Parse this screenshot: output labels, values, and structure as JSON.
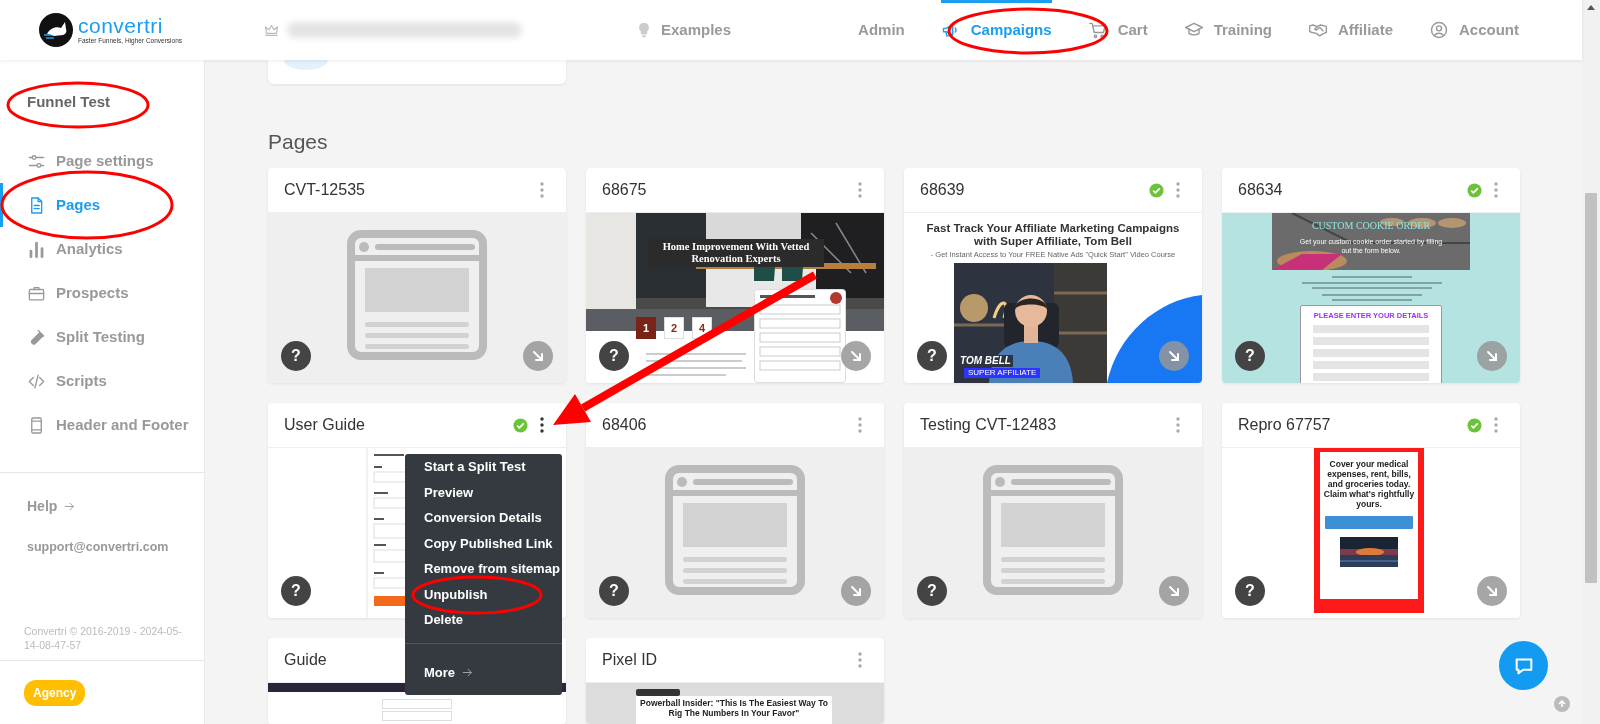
{
  "header": {
    "logo": "convertri",
    "tagline": "Faster Funnels, Higher Conversions",
    "examples": "Examples",
    "nav": [
      {
        "label": "Admin",
        "selected": false
      },
      {
        "label": "Campaigns",
        "selected": true
      },
      {
        "label": "Cart",
        "selected": false
      },
      {
        "label": "Training",
        "selected": false
      },
      {
        "label": "Affiliate",
        "selected": false
      },
      {
        "label": "Account",
        "selected": false
      }
    ]
  },
  "sidebar": {
    "title": "Funnel Test",
    "items": [
      {
        "label": "Page settings",
        "selected": false
      },
      {
        "label": "Pages",
        "selected": true
      },
      {
        "label": "Analytics",
        "selected": false
      },
      {
        "label": "Prospects",
        "selected": false
      },
      {
        "label": "Split Testing",
        "selected": false
      },
      {
        "label": "Scripts",
        "selected": false
      },
      {
        "label": "Header and Footer",
        "selected": false
      }
    ],
    "help": "Help",
    "support_email": "support@convertri.com",
    "copyright": "Convertri © 2016-2019 - 2024-05-14-08-47-57",
    "badge": "Agency"
  },
  "main": {
    "heading": "Pages",
    "cards": [
      {
        "title": "CVT-12535",
        "published": false,
        "menu_button": true,
        "help": "?",
        "open_button": true,
        "preview": {
          "kind": "placeholder"
        }
      },
      {
        "title": "68675",
        "published": false,
        "menu_button": true,
        "help": "?",
        "open_button": true,
        "preview": {
          "kind": "hero",
          "headline": "Home Improvement With Vetted Renovation Experts",
          "steps": [
            {
              "label": "1",
              "selected": true
            },
            {
              "label": "2",
              "selected": false
            },
            {
              "label": "4",
              "selected": false
            }
          ]
        }
      },
      {
        "title": "68639",
        "published": true,
        "menu_button": true,
        "help": "?",
        "open_button": true,
        "preview": {
          "kind": "video_promo",
          "headline": "Fast Track Your Affiliate Marketing Campaigns with Super Affiliate, Tom Bell",
          "subtitle": "- Get Instant Access to Your FREE Native Ads \"Quick Start\" Video Course",
          "name_tag": "TOM BELL",
          "role_tag": "SUPER AFFILIATE"
        }
      },
      {
        "title": "68634",
        "published": true,
        "menu_button": true,
        "help": "?",
        "open_button": true,
        "preview": {
          "kind": "cookie_form",
          "banner_title": "CUSTOM COOKIE ORDER",
          "banner_text": "Get your custom cookie order started by filling out the form below.",
          "form_title": "PLEASE ENTER YOUR DETAILS"
        }
      },
      {
        "title": "User Guide",
        "published": true,
        "menu_button": true,
        "help": "?",
        "open_button": false,
        "menu_open": true,
        "preview": {
          "kind": "form_doc"
        }
      },
      {
        "title": "68406",
        "published": false,
        "menu_button": true,
        "help": "?",
        "open_button": true,
        "preview": {
          "kind": "placeholder"
        }
      },
      {
        "title": "Testing CVT-12483",
        "published": false,
        "menu_button": true,
        "help": "?",
        "open_button": true,
        "preview": {
          "kind": "placeholder"
        }
      },
      {
        "title": "Repro 67757",
        "published": true,
        "menu_button": true,
        "help": "?",
        "open_button": true,
        "preview": {
          "kind": "offer",
          "text": "Cover your medical expenses, rent, bills, and groceries today. Claim what's rightfully yours."
        }
      },
      {
        "title": "Guide",
        "menu_button": false,
        "preview": {
          "kind": "dark_banner"
        }
      },
      {
        "title": "Pixel ID",
        "menu_button": true,
        "preview": {
          "kind": "article",
          "headline": "Powerball Insider: \"This Is The Easiest Way To Rig The Numbers In Your Favor\""
        }
      }
    ],
    "context_menu": {
      "items": [
        "Start a Split Test",
        "Preview",
        "Conversion Details",
        "Copy Published Link",
        "Remove from sitemap",
        "Unpublish",
        "Delete"
      ],
      "more": "More"
    }
  }
}
